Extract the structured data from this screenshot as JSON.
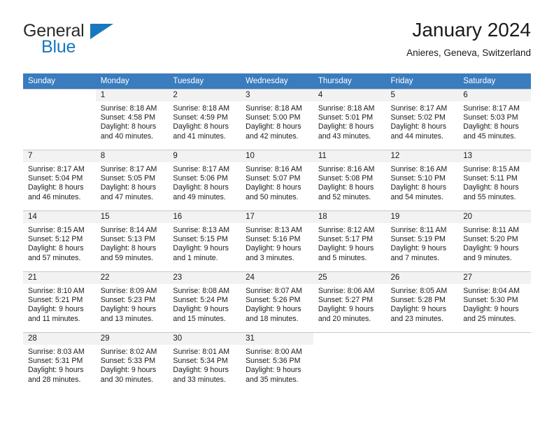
{
  "brand": {
    "name_top": "General",
    "name_bottom": "Blue",
    "color_blue": "#1878be",
    "color_dark": "#2b2b2b"
  },
  "header": {
    "title": "January 2024",
    "subtitle": "Anieres, Geneva, Switzerland",
    "accent": "#3a7cbe"
  },
  "calendar": {
    "weekday_headers": [
      "Sunday",
      "Monday",
      "Tuesday",
      "Wednesday",
      "Thursday",
      "Friday",
      "Saturday"
    ],
    "weeks": [
      [
        {
          "day": "",
          "lines": []
        },
        {
          "day": "1",
          "lines": [
            "Sunrise: 8:18 AM",
            "Sunset: 4:58 PM",
            "Daylight: 8 hours",
            "and 40 minutes."
          ]
        },
        {
          "day": "2",
          "lines": [
            "Sunrise: 8:18 AM",
            "Sunset: 4:59 PM",
            "Daylight: 8 hours",
            "and 41 minutes."
          ]
        },
        {
          "day": "3",
          "lines": [
            "Sunrise: 8:18 AM",
            "Sunset: 5:00 PM",
            "Daylight: 8 hours",
            "and 42 minutes."
          ]
        },
        {
          "day": "4",
          "lines": [
            "Sunrise: 8:18 AM",
            "Sunset: 5:01 PM",
            "Daylight: 8 hours",
            "and 43 minutes."
          ]
        },
        {
          "day": "5",
          "lines": [
            "Sunrise: 8:17 AM",
            "Sunset: 5:02 PM",
            "Daylight: 8 hours",
            "and 44 minutes."
          ]
        },
        {
          "day": "6",
          "lines": [
            "Sunrise: 8:17 AM",
            "Sunset: 5:03 PM",
            "Daylight: 8 hours",
            "and 45 minutes."
          ]
        }
      ],
      [
        {
          "day": "7",
          "lines": [
            "Sunrise: 8:17 AM",
            "Sunset: 5:04 PM",
            "Daylight: 8 hours",
            "and 46 minutes."
          ]
        },
        {
          "day": "8",
          "lines": [
            "Sunrise: 8:17 AM",
            "Sunset: 5:05 PM",
            "Daylight: 8 hours",
            "and 47 minutes."
          ]
        },
        {
          "day": "9",
          "lines": [
            "Sunrise: 8:17 AM",
            "Sunset: 5:06 PM",
            "Daylight: 8 hours",
            "and 49 minutes."
          ]
        },
        {
          "day": "10",
          "lines": [
            "Sunrise: 8:16 AM",
            "Sunset: 5:07 PM",
            "Daylight: 8 hours",
            "and 50 minutes."
          ]
        },
        {
          "day": "11",
          "lines": [
            "Sunrise: 8:16 AM",
            "Sunset: 5:08 PM",
            "Daylight: 8 hours",
            "and 52 minutes."
          ]
        },
        {
          "day": "12",
          "lines": [
            "Sunrise: 8:16 AM",
            "Sunset: 5:10 PM",
            "Daylight: 8 hours",
            "and 54 minutes."
          ]
        },
        {
          "day": "13",
          "lines": [
            "Sunrise: 8:15 AM",
            "Sunset: 5:11 PM",
            "Daylight: 8 hours",
            "and 55 minutes."
          ]
        }
      ],
      [
        {
          "day": "14",
          "lines": [
            "Sunrise: 8:15 AM",
            "Sunset: 5:12 PM",
            "Daylight: 8 hours",
            "and 57 minutes."
          ]
        },
        {
          "day": "15",
          "lines": [
            "Sunrise: 8:14 AM",
            "Sunset: 5:13 PM",
            "Daylight: 8 hours",
            "and 59 minutes."
          ]
        },
        {
          "day": "16",
          "lines": [
            "Sunrise: 8:13 AM",
            "Sunset: 5:15 PM",
            "Daylight: 9 hours",
            "and 1 minute."
          ]
        },
        {
          "day": "17",
          "lines": [
            "Sunrise: 8:13 AM",
            "Sunset: 5:16 PM",
            "Daylight: 9 hours",
            "and 3 minutes."
          ]
        },
        {
          "day": "18",
          "lines": [
            "Sunrise: 8:12 AM",
            "Sunset: 5:17 PM",
            "Daylight: 9 hours",
            "and 5 minutes."
          ]
        },
        {
          "day": "19",
          "lines": [
            "Sunrise: 8:11 AM",
            "Sunset: 5:19 PM",
            "Daylight: 9 hours",
            "and 7 minutes."
          ]
        },
        {
          "day": "20",
          "lines": [
            "Sunrise: 8:11 AM",
            "Sunset: 5:20 PM",
            "Daylight: 9 hours",
            "and 9 minutes."
          ]
        }
      ],
      [
        {
          "day": "21",
          "lines": [
            "Sunrise: 8:10 AM",
            "Sunset: 5:21 PM",
            "Daylight: 9 hours",
            "and 11 minutes."
          ]
        },
        {
          "day": "22",
          "lines": [
            "Sunrise: 8:09 AM",
            "Sunset: 5:23 PM",
            "Daylight: 9 hours",
            "and 13 minutes."
          ]
        },
        {
          "day": "23",
          "lines": [
            "Sunrise: 8:08 AM",
            "Sunset: 5:24 PM",
            "Daylight: 9 hours",
            "and 15 minutes."
          ]
        },
        {
          "day": "24",
          "lines": [
            "Sunrise: 8:07 AM",
            "Sunset: 5:26 PM",
            "Daylight: 9 hours",
            "and 18 minutes."
          ]
        },
        {
          "day": "25",
          "lines": [
            "Sunrise: 8:06 AM",
            "Sunset: 5:27 PM",
            "Daylight: 9 hours",
            "and 20 minutes."
          ]
        },
        {
          "day": "26",
          "lines": [
            "Sunrise: 8:05 AM",
            "Sunset: 5:28 PM",
            "Daylight: 9 hours",
            "and 23 minutes."
          ]
        },
        {
          "day": "27",
          "lines": [
            "Sunrise: 8:04 AM",
            "Sunset: 5:30 PM",
            "Daylight: 9 hours",
            "and 25 minutes."
          ]
        }
      ],
      [
        {
          "day": "28",
          "lines": [
            "Sunrise: 8:03 AM",
            "Sunset: 5:31 PM",
            "Daylight: 9 hours",
            "and 28 minutes."
          ]
        },
        {
          "day": "29",
          "lines": [
            "Sunrise: 8:02 AM",
            "Sunset: 5:33 PM",
            "Daylight: 9 hours",
            "and 30 minutes."
          ]
        },
        {
          "day": "30",
          "lines": [
            "Sunrise: 8:01 AM",
            "Sunset: 5:34 PM",
            "Daylight: 9 hours",
            "and 33 minutes."
          ]
        },
        {
          "day": "31",
          "lines": [
            "Sunrise: 8:00 AM",
            "Sunset: 5:36 PM",
            "Daylight: 9 hours",
            "and 35 minutes."
          ]
        },
        {
          "day": "",
          "lines": []
        },
        {
          "day": "",
          "lines": []
        },
        {
          "day": "",
          "lines": []
        }
      ]
    ]
  }
}
